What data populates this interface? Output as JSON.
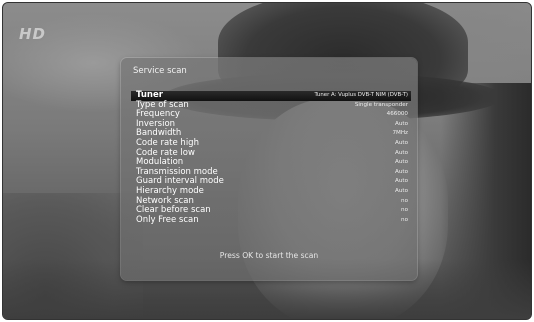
{
  "channel_logo": "HD",
  "colors": {
    "panel": "#787878",
    "selected_row": "#111111",
    "text": "#ffffff"
  },
  "dialog": {
    "title": "Service scan",
    "rows": [
      {
        "label": "Tuner",
        "value": "Tuner A: Vuplus DVB-T NIM (DVB-T)"
      },
      {
        "label": "Type of scan",
        "value": "Single transponder"
      },
      {
        "label": "Frequency",
        "value": "466000"
      },
      {
        "label": "Inversion",
        "value": "Auto"
      },
      {
        "label": "Bandwidth",
        "value": "7MHz"
      },
      {
        "label": "Code rate high",
        "value": "Auto"
      },
      {
        "label": "Code rate low",
        "value": "Auto"
      },
      {
        "label": "Modulation",
        "value": "Auto"
      },
      {
        "label": "Transmission mode",
        "value": "Auto"
      },
      {
        "label": "Guard interval mode",
        "value": "Auto"
      },
      {
        "label": "Hierarchy mode",
        "value": "Auto"
      },
      {
        "label": "Network scan",
        "value": "no"
      },
      {
        "label": "Clear before scan",
        "value": "no"
      },
      {
        "label": "Only Free scan",
        "value": "no"
      }
    ],
    "selected_index": 0,
    "footer": "Press OK to start the scan"
  }
}
